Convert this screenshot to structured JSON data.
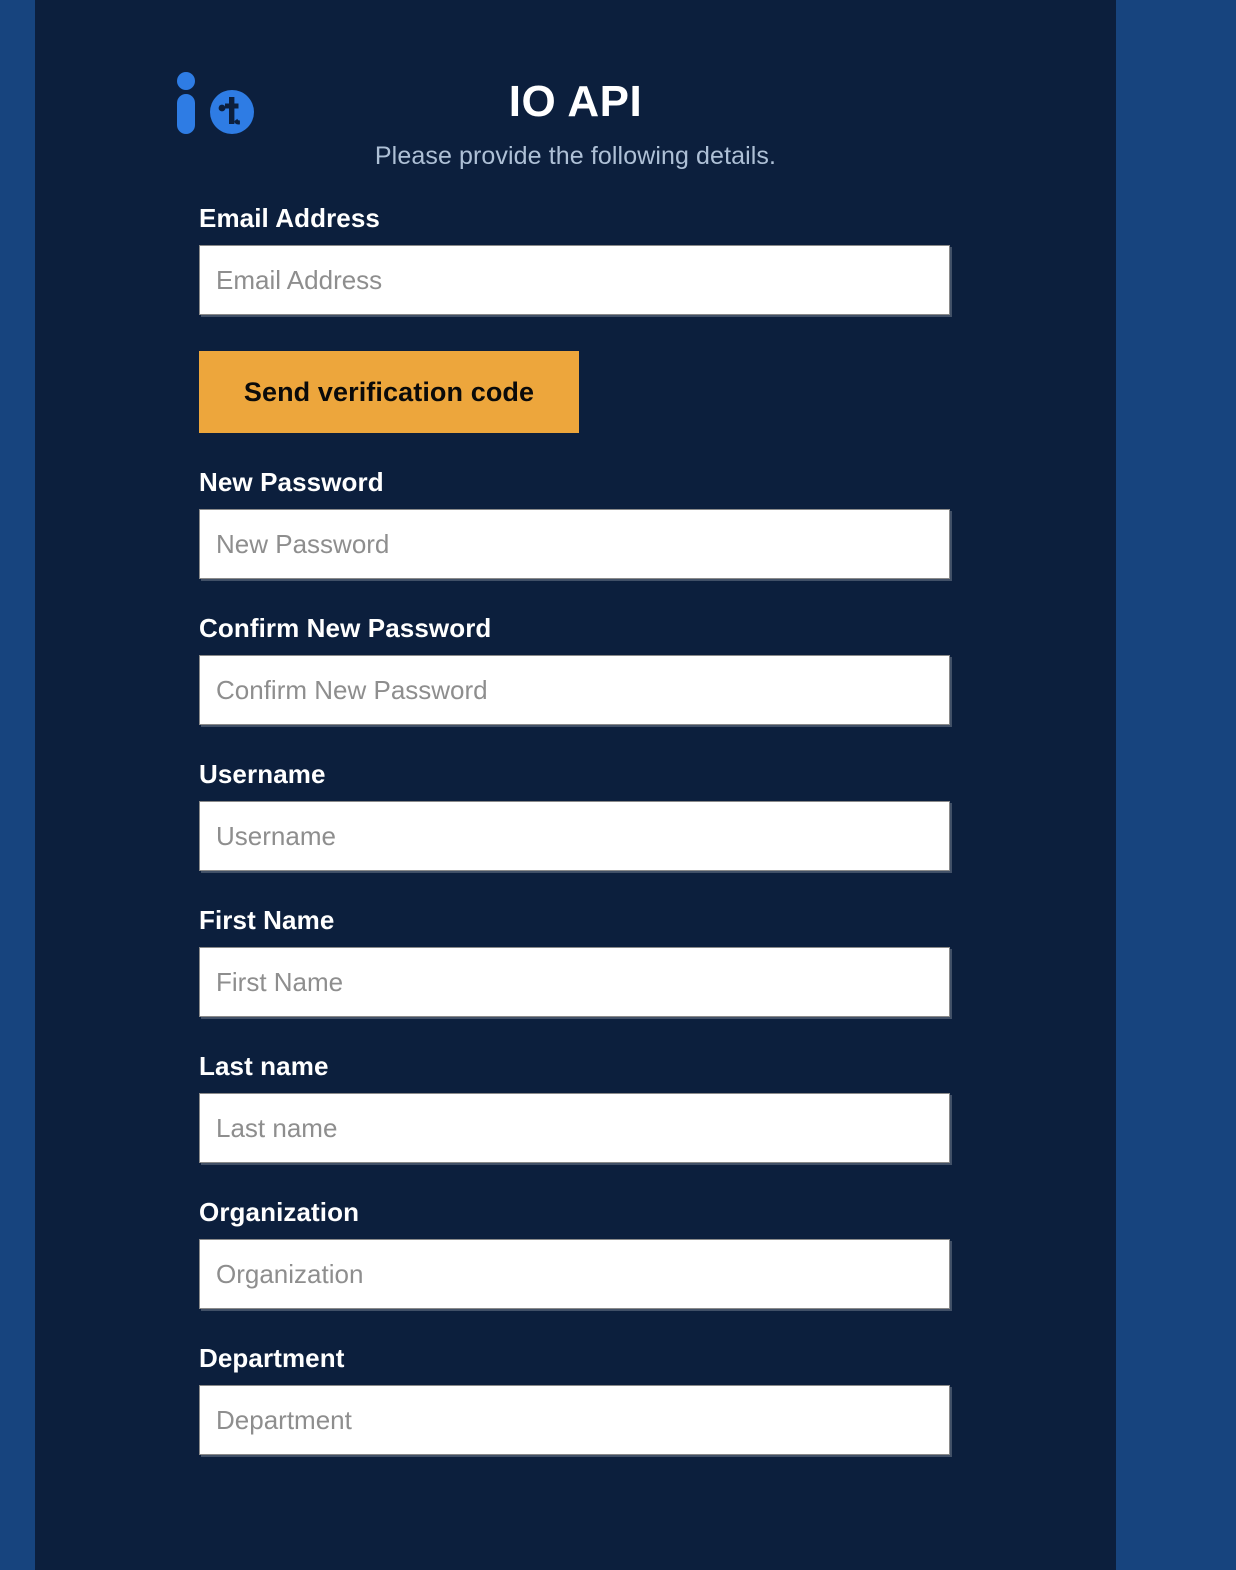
{
  "header": {
    "logo_name": "io-brand-logo",
    "logo_mark_text": "it",
    "title": "IO API",
    "subtitle": "Please provide the following details."
  },
  "colors": {
    "page_background": "#17447E",
    "card_background": "#0C1F3D",
    "accent_orange": "#EDA63C",
    "logo_blue": "#2E7CE4",
    "subtitle_text": "#AEC0D6",
    "label_text": "#FFFFFF",
    "placeholder_text": "#8E8E8E"
  },
  "form": {
    "fields": [
      {
        "label": "Email Address",
        "placeholder": "Email Address",
        "value": "",
        "type": "email",
        "name": "email-address"
      },
      {
        "label": "New Password",
        "placeholder": "New Password",
        "value": "",
        "type": "password",
        "name": "new-password"
      },
      {
        "label": "Confirm New Password",
        "placeholder": "Confirm New Password",
        "value": "",
        "type": "password",
        "name": "confirm-new-password"
      },
      {
        "label": "Username",
        "placeholder": "Username",
        "value": "",
        "type": "text",
        "name": "username"
      },
      {
        "label": "First Name",
        "placeholder": "First Name",
        "value": "",
        "type": "text",
        "name": "first-name"
      },
      {
        "label": "Last name",
        "placeholder": "Last name",
        "value": "",
        "type": "text",
        "name": "last-name"
      },
      {
        "label": "Organization",
        "placeholder": "Organization",
        "value": "",
        "type": "text",
        "name": "organization"
      },
      {
        "label": "Department",
        "placeholder": "Department",
        "value": "",
        "type": "text",
        "name": "department"
      }
    ],
    "send_verification_code_label": "Send verification code"
  }
}
